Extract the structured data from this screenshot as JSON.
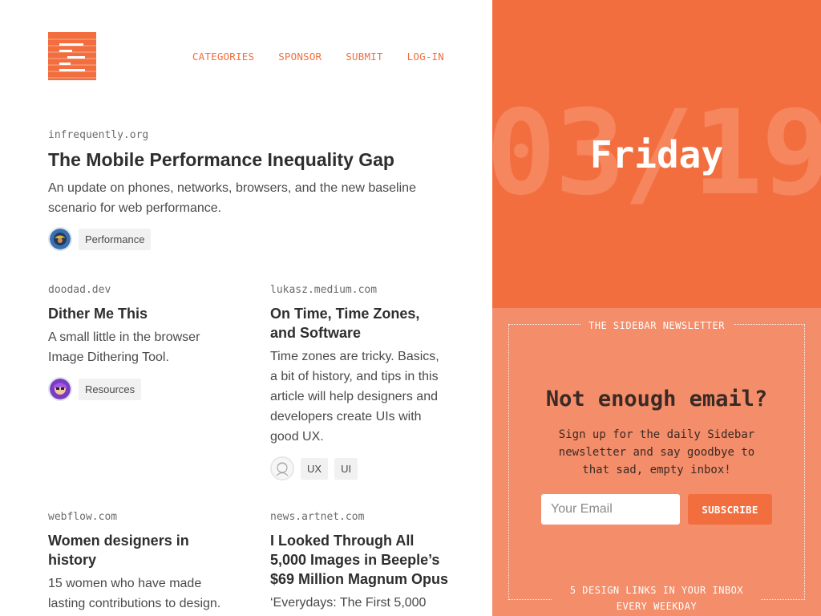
{
  "nav": {
    "logo_icon": "sidebar-logo-icon",
    "items": [
      "CATEGORIES",
      "SPONSOR",
      "SUBMIT",
      "LOG-IN"
    ]
  },
  "featured": {
    "domain": "infrequently.org",
    "title": "The Mobile Performance Inequality Gap",
    "description": "An update on phones, networks, browsers, and the new baseline scenario for web performance.",
    "tags": [
      "Performance"
    ]
  },
  "posts": [
    {
      "domain": "doodad.dev",
      "title": "Dither Me This",
      "description": "A small little in the browser Image Dithering Tool.",
      "tags": [
        "Resources"
      ]
    },
    {
      "domain": "lukasz.medium.com",
      "title": "On Time, Time Zones, and Software",
      "description": "Time zones are tricky. Basics, a bit of history, and tips in this article will help designers and developers create UIs with good UX.",
      "tags": [
        "UX",
        "UI"
      ]
    },
    {
      "domain": "webflow.com",
      "title": "Women designers in history",
      "description": "15 women who have made lasting contributions to design."
    },
    {
      "domain": "news.artnet.com",
      "title": "I Looked Through All 5,000 Images in Beeple’s $69 Million Magnum Opus",
      "description": "‘Everydays: The First 5,000"
    }
  ],
  "date_panel": {
    "big_date": "03/19",
    "day": "Friday"
  },
  "newsletter": {
    "label": "THE SIDEBAR NEWSLETTER",
    "heading": "Not enough email?",
    "text": "Sign up for the daily Sidebar newsletter and say goodbye to that sad, empty inbox!",
    "email_placeholder": "Your Email",
    "subscribe_label": "SUBSCRIBE",
    "footer": "5 DESIGN LINKS IN YOUR INBOX EVERY WEEKDAY"
  },
  "colors": {
    "accent": "#f36e3e",
    "accent_light": "#f48d6a",
    "text_dark": "#2e2e2e"
  }
}
